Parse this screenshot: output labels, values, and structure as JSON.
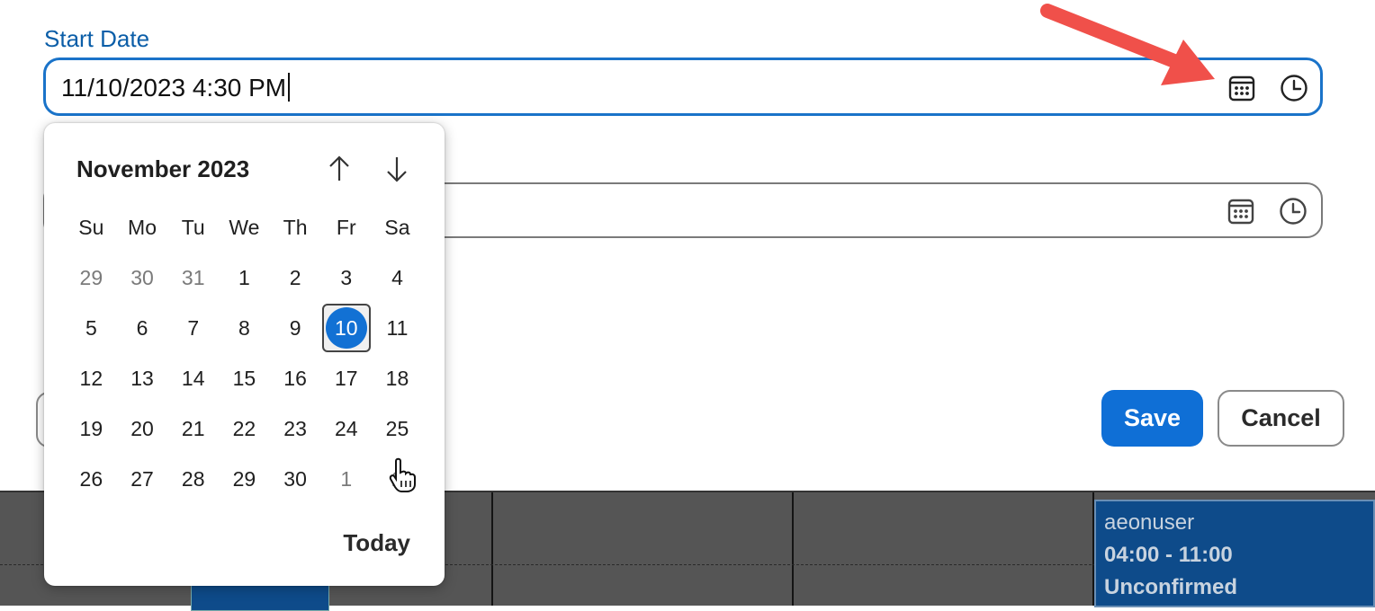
{
  "form": {
    "start_label": "Start Date",
    "start_value": "11/10/2023 4:30 PM",
    "end_value": "",
    "save_label": "Save",
    "cancel_label": "Cancel"
  },
  "icons": {
    "calendar": "calendar-icon",
    "clock": "clock-icon",
    "arrow_up": "arrow-up-icon",
    "arrow_down": "arrow-down-icon",
    "cursor": "hand-pointer-icon"
  },
  "calendar": {
    "month_title": "November 2023",
    "weekdays": [
      "Su",
      "Mo",
      "Tu",
      "We",
      "Th",
      "Fr",
      "Sa"
    ],
    "weeks": [
      [
        {
          "d": "29",
          "m": true
        },
        {
          "d": "30",
          "m": true
        },
        {
          "d": "31",
          "m": true
        },
        {
          "d": "1"
        },
        {
          "d": "2"
        },
        {
          "d": "3"
        },
        {
          "d": "4"
        }
      ],
      [
        {
          "d": "5"
        },
        {
          "d": "6"
        },
        {
          "d": "7"
        },
        {
          "d": "8"
        },
        {
          "d": "9"
        },
        {
          "d": "10",
          "sel": true
        },
        {
          "d": "11"
        }
      ],
      [
        {
          "d": "12"
        },
        {
          "d": "13"
        },
        {
          "d": "14"
        },
        {
          "d": "15"
        },
        {
          "d": "16"
        },
        {
          "d": "17"
        },
        {
          "d": "18"
        }
      ],
      [
        {
          "d": "19"
        },
        {
          "d": "20"
        },
        {
          "d": "21"
        },
        {
          "d": "22"
        },
        {
          "d": "23"
        },
        {
          "d": "24"
        },
        {
          "d": "25"
        }
      ],
      [
        {
          "d": "26"
        },
        {
          "d": "27"
        },
        {
          "d": "28"
        },
        {
          "d": "29"
        },
        {
          "d": "30"
        },
        {
          "d": "1",
          "m": true
        },
        {
          "d": "2",
          "m": true
        }
      ]
    ],
    "today_label": "Today"
  },
  "schedule_event": {
    "user": "aeonuser",
    "time": "04:00 - 11:00",
    "status": "Unconfirmed"
  },
  "colors": {
    "accent": "#0f6fd6",
    "label": "#0b5ea8",
    "annotation_arrow": "#f0504a",
    "event_bg": "#0e4b8a"
  }
}
